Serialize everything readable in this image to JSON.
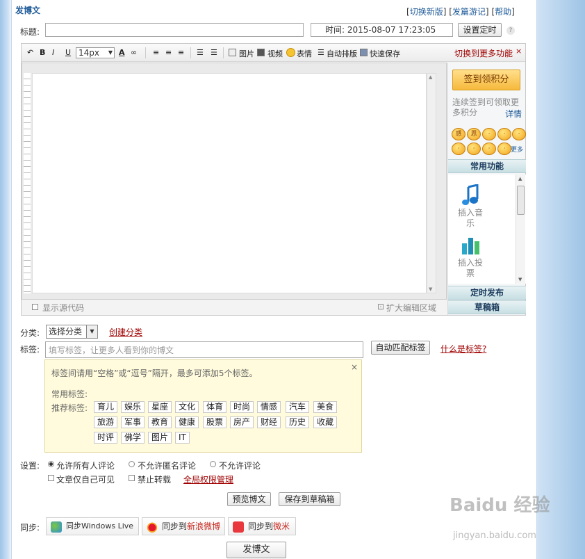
{
  "header": {
    "title": "发博文",
    "links_text": {
      "open1": "[",
      "switch_new": "切换新版",
      "close1": "]",
      "open2": "[",
      "travelogue": "发篇游记",
      "close2": "]",
      "open3": "[",
      "help": "帮助",
      "close3": "]"
    }
  },
  "title_row": {
    "label": "标题:",
    "title_value": "",
    "time_label": "时间: 2015-08-07 17:23:05",
    "set_time_button": "设置定时",
    "help_icon_text": "?"
  },
  "toolbar": {
    "font_size": "14px",
    "bold": "B",
    "italic": "I",
    "underline": "U",
    "picture": "图片",
    "video": "视频",
    "emotion": "表情",
    "auto_layout": "自动排版",
    "quick_save": "快速保存",
    "more_functions": "切换到更多功能",
    "more_close": "×"
  },
  "editor": {
    "show_source": "显示源代码",
    "expand_area": "扩大编辑区域"
  },
  "sidebar": {
    "sign_button": "签到领积分",
    "sign_note": "连续签到可领取更多积分",
    "details": "详情",
    "emotions": [
      "感",
      "恩",
      "·",
      "·",
      "·",
      "·",
      "·",
      "·",
      "·"
    ],
    "more_emotion": "更多",
    "common_functions": "常用功能",
    "insert_music": "插入音乐",
    "insert_vote": "插入投票",
    "scheduled_publish": "定时发布",
    "drafts": "草稿箱"
  },
  "category": {
    "label": "分类:",
    "selected": "选择分类",
    "create": "创建分类"
  },
  "tags": {
    "label": "标签:",
    "placeholder": "填写标签，让更多人看到你的博文",
    "auto_match": "自动匹配标签",
    "what_is": "什么是标签?",
    "hint": "标签间请用“空格”或“逗号”隔开，最多可添加5个标签。",
    "common_label": "常用标签:",
    "recommended_label": "推荐标签:",
    "recommended": [
      "育儿",
      "娱乐",
      "星座",
      "文化",
      "体育",
      "时尚",
      "情感",
      "汽车",
      "美食",
      "旅游",
      "军事",
      "教育",
      "健康",
      "股票",
      "房产",
      "财经",
      "历史",
      "收藏",
      "时评",
      "佛学",
      "图片",
      "IT"
    ],
    "close": "×"
  },
  "settings": {
    "label": "设置:",
    "allow_all": "允许所有人评论",
    "no_anonymous": "不允许匿名评论",
    "no_comment": "不允许评论",
    "only_me": "文章仅自己可见",
    "no_repost": "禁止转载",
    "global_perm": "全局权限管理"
  },
  "actions": {
    "preview": "预览博文",
    "save_draft": "保存到草稿箱",
    "publish": "发博文"
  },
  "sync": {
    "label": "同步:",
    "windows_live": "同步Windows Live",
    "weibo_prefix": "同步到",
    "weibo_name": "新浪微博",
    "weimi_prefix": "同步到",
    "weimi_name": "微米"
  },
  "watermark": {
    "brand": "Baidu 经验",
    "url": "jingyan.baidu.com"
  },
  "colors": {
    "link_blue": "#1d5a98",
    "link_red": "#a00000",
    "accent_orange": "#f6b93b"
  }
}
